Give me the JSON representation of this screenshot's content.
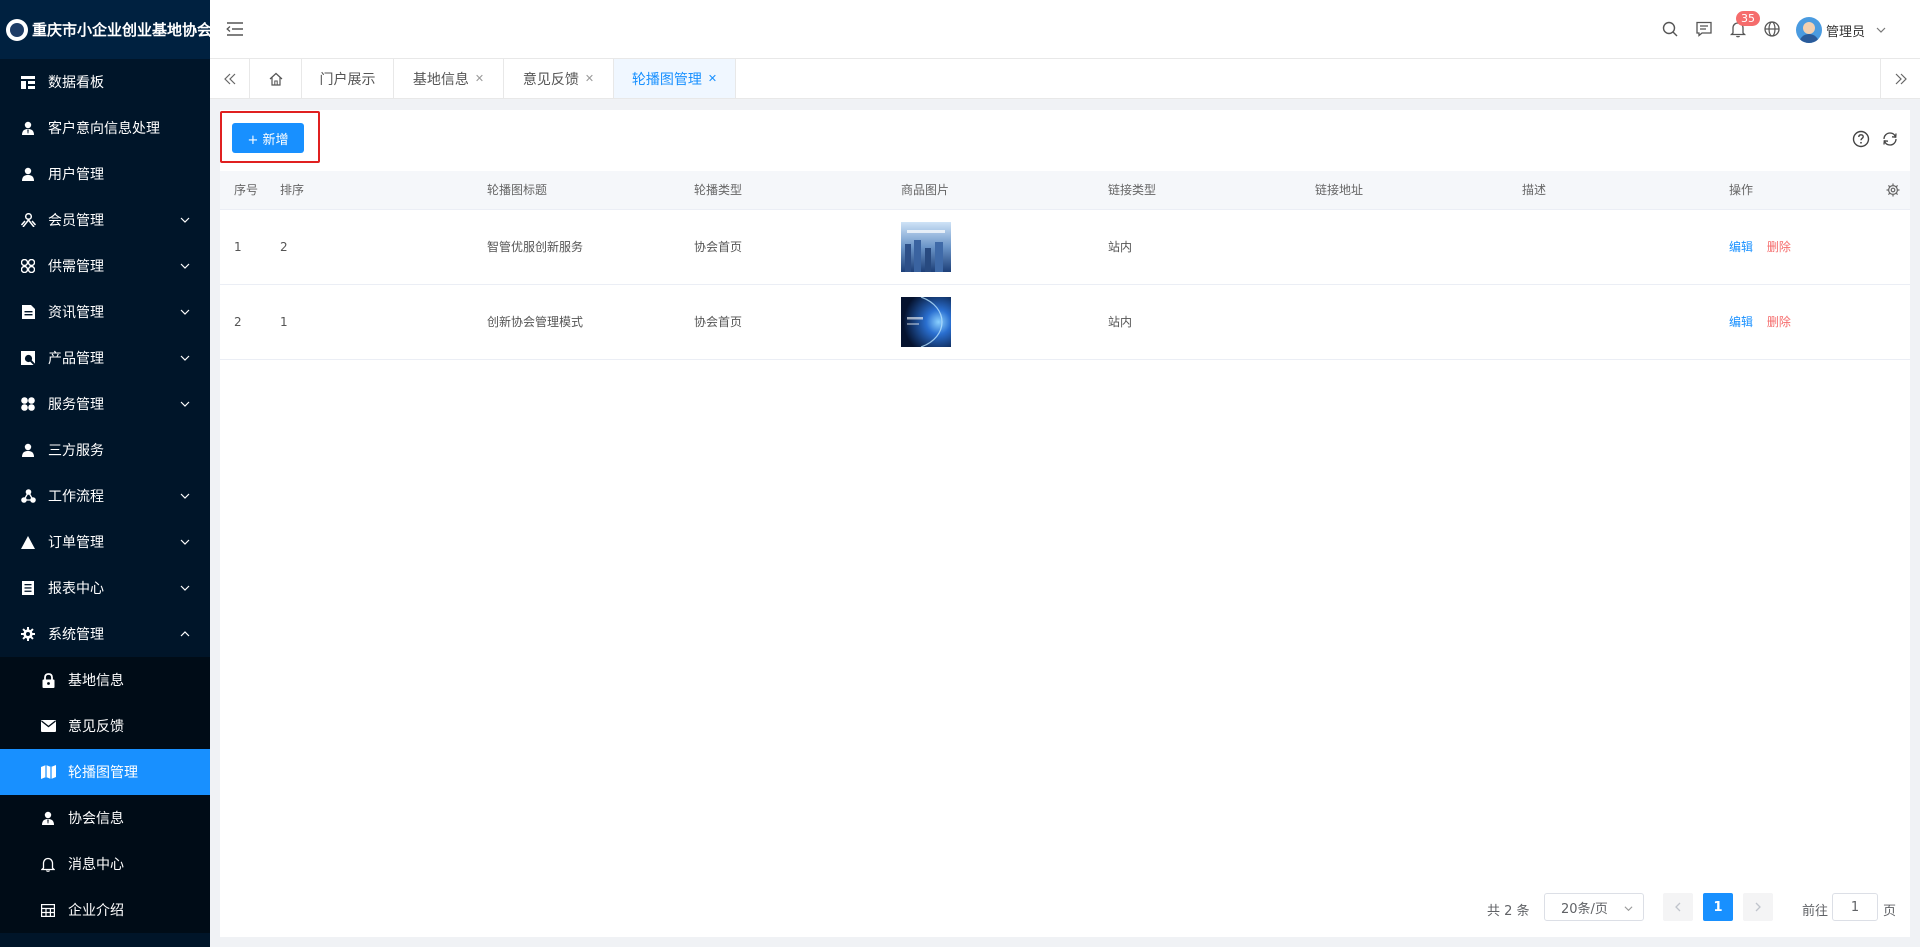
{
  "app": {
    "title": "重庆市小企业创业基地协会"
  },
  "sidebar": {
    "items": [
      {
        "label": "数据看板",
        "icon": "dashboard-icon",
        "arrow": false
      },
      {
        "label": "客户意向信息处理",
        "icon": "user-tie-icon",
        "arrow": false
      },
      {
        "label": "用户管理",
        "icon": "user-icon",
        "arrow": false
      },
      {
        "label": "会员管理",
        "icon": "members-icon",
        "arrow": true
      },
      {
        "label": "供需管理",
        "icon": "clover-icon",
        "arrow": true
      },
      {
        "label": "资讯管理",
        "icon": "document-icon",
        "arrow": true
      },
      {
        "label": "产品管理",
        "icon": "product-icon",
        "arrow": true
      },
      {
        "label": "服务管理",
        "icon": "service-icon",
        "arrow": true
      },
      {
        "label": "三方服务",
        "icon": "user-icon",
        "arrow": false
      },
      {
        "label": "工作流程",
        "icon": "workflow-icon",
        "arrow": true
      },
      {
        "label": "订单管理",
        "icon": "triangle-icon",
        "arrow": true
      },
      {
        "label": "报表中心",
        "icon": "report-icon",
        "arrow": true
      },
      {
        "label": "系统管理",
        "icon": "gear-icon",
        "arrow": true
      }
    ],
    "sub_items": [
      {
        "label": "基地信息",
        "icon": "lock-icon"
      },
      {
        "label": "意见反馈",
        "icon": "mail-icon"
      },
      {
        "label": "轮播图管理",
        "icon": "map-icon"
      },
      {
        "label": "协会信息",
        "icon": "user-tie-icon"
      },
      {
        "label": "消息中心",
        "icon": "bell-icon"
      },
      {
        "label": "企业介绍",
        "icon": "grid-icon"
      }
    ]
  },
  "header": {
    "notification_count": "35",
    "username": "管理员"
  },
  "tabs": [
    {
      "label": "门户展示",
      "closable": false
    },
    {
      "label": "基地信息",
      "closable": true
    },
    {
      "label": "意见反馈",
      "closable": true
    },
    {
      "label": "轮播图管理",
      "closable": true
    }
  ],
  "tab_close_glyph": "✕",
  "toolbar": {
    "add_label": "+ 新增"
  },
  "table": {
    "columns": [
      "序号",
      "排序",
      "轮播图标题",
      "轮播类型",
      "商品图片",
      "链接类型",
      "链接地址",
      "描述",
      "操作"
    ],
    "rows": [
      {
        "index": "1",
        "sort": "2",
        "title": "智管优服创新服务",
        "type": "协会首页",
        "link_type": "站内",
        "link": "",
        "desc": ""
      },
      {
        "index": "2",
        "sort": "1",
        "title": "创新协会管理模式",
        "type": "协会首页",
        "link_type": "站内",
        "link": "",
        "desc": ""
      }
    ],
    "edit_label": "编辑",
    "delete_label": "删除"
  },
  "pagination": {
    "total": "共 2 条",
    "page_size": "20条/页",
    "current_page": "1",
    "goto_label": "前往",
    "goto_value": "1",
    "goto_suffix": "页"
  },
  "colors": {
    "primary": "#1890ff",
    "sidebar_bg": "#001529",
    "danger": "#f56c6c",
    "highlight_border": "#e02020"
  }
}
